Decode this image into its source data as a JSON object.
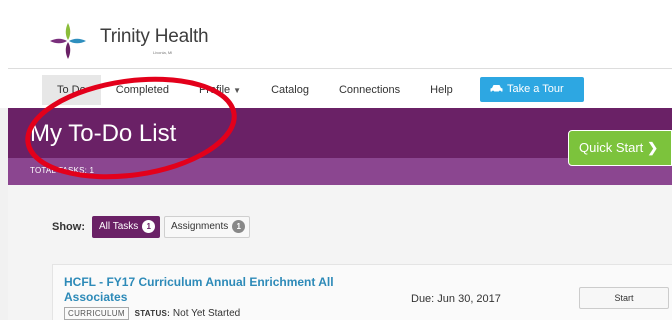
{
  "brand": {
    "name": "Trinity Health",
    "sub": "Livonia, MI",
    "colors": {
      "purple": "#6a2166",
      "light_purple": "#8b4690",
      "green": "#7cc33c",
      "blue": "#2da7e2",
      "annotation": "#e3001b"
    },
    "logo_icon": "trinity-cross-icon"
  },
  "nav": {
    "items": [
      {
        "label": "To Do",
        "active": true
      },
      {
        "label": "Completed"
      },
      {
        "label": "Profile"
      },
      {
        "label": "Catalog"
      },
      {
        "label": "Connections"
      },
      {
        "label": "Help"
      }
    ],
    "profile_caret_icon": "chevron-down-icon",
    "tour": {
      "label": "Take a Tour",
      "icon": "car-icon"
    }
  },
  "banner": {
    "title": "My To-Do List",
    "total_tasks_label": "TOTAL TASKS",
    "total_tasks_value": "1",
    "quick_start": "Quick Start",
    "quick_start_icon": "chevron-right-icon"
  },
  "filters": {
    "show_label": "Show:",
    "all_tasks": {
      "label": "All Tasks",
      "count": "1"
    },
    "assignments": {
      "label": "Assignments",
      "count": "1"
    }
  },
  "task": {
    "title": "HCFL - FY17 Curriculum Annual Enrichment All Associates",
    "type_tag": "CURRICULUM",
    "status_key": "STATUS:",
    "status_value": "Not Yet Started",
    "due": "Due: Jun 30, 2017",
    "action": "Start"
  }
}
